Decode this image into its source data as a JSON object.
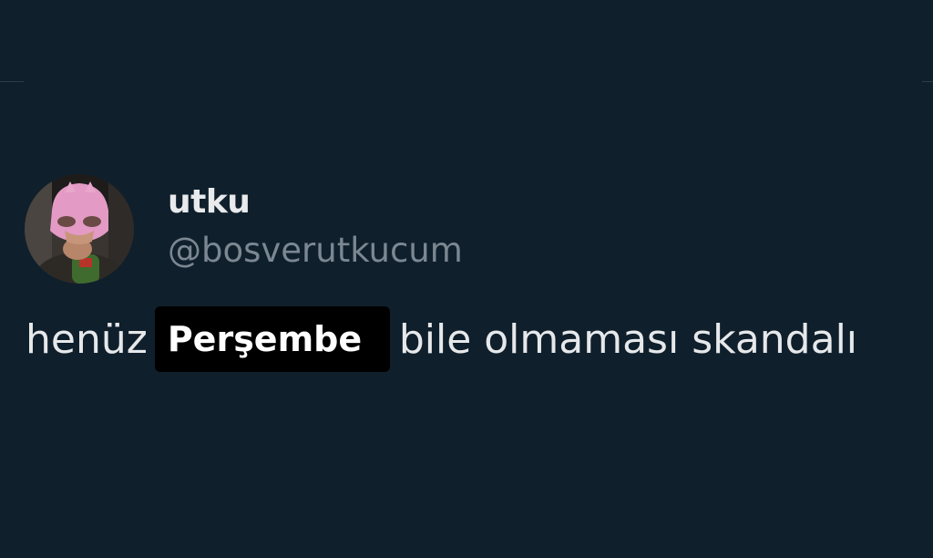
{
  "tweet": {
    "author": {
      "display_name": "utku",
      "handle": "@bosverutkucum",
      "avatar_icon": "profile-photo-pink-mask"
    },
    "text_before": "henüz",
    "highlighted_word": "Perşembe",
    "text_after": "bile olmaması skandalı"
  },
  "colors": {
    "background": "#0f1f2c",
    "text": "#e6e8ea",
    "muted": "#7b8791",
    "highlight_bg": "#000000"
  }
}
